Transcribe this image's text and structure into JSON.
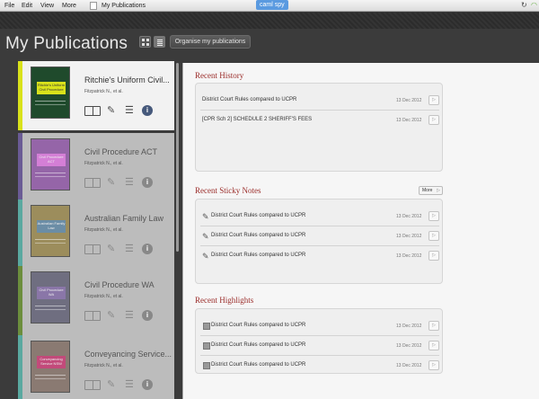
{
  "menubar": {
    "items": [
      "File",
      "Edit",
      "View",
      "More"
    ],
    "window_title": "My Publications",
    "tag": "caml spy"
  },
  "header": {
    "title": "My Publications",
    "organise_label": "Organise my publications"
  },
  "publications": [
    {
      "title": "Ritchie's Uniform Civil...",
      "author": "Fitzpatrick N., et al.",
      "accent": "#d9e21b",
      "cover_color": "#1f4a2c",
      "label_color": "#d9e21b",
      "cover_text": "Ritchie's Uniform Civil Procedure"
    },
    {
      "title": "Civil Procedure ACT",
      "author": "Fitzpatrick N., et al.",
      "accent": "#6a5b95",
      "cover_color": "#9565a8",
      "label_color": "#d47fd6",
      "cover_text": "Civil Procedure ACT"
    },
    {
      "title": "Australian Family Law",
      "author": "Fitzpatrick N., et al.",
      "accent": "#5aa9a0",
      "cover_color": "#9c8d5c",
      "label_color": "#6b8da6",
      "cover_text": "Australian Family Law"
    },
    {
      "title": "Civil Procedure WA",
      "author": "Fitzpatrick N., et al.",
      "accent": "#6c8e3d",
      "cover_color": "#6f6e80",
      "label_color": "#8a76a8",
      "cover_text": "Civil Procedure WA"
    },
    {
      "title": "Conveyancing Service...",
      "author": "Fitzpatrick N., et al.",
      "accent": "#5aa9a0",
      "cover_color": "#8a7a72",
      "label_color": "#c24a7a",
      "cover_text": "Conveyancing Service NSW"
    }
  ],
  "recent_history": {
    "title": "Recent History",
    "items": [
      {
        "text": "District Court Rules compared to UCPR",
        "date": "13 Dec 2012"
      },
      {
        "text": "[CPR Sch 2] SCHEDULE 2 SHERIFF'S FEES",
        "date": "13 Dec 2012"
      }
    ]
  },
  "recent_sticky_notes": {
    "title": "Recent Sticky Notes",
    "more_label": "More",
    "items": [
      {
        "text": "District Court Rules compared to UCPR",
        "date": "13 Dec 2012"
      },
      {
        "text": "District Court Rules compared to UCPR",
        "date": "13 Dec 2012"
      },
      {
        "text": "District Court Rules compared to UCPR",
        "date": "13 Dec 2012"
      }
    ]
  },
  "recent_highlights": {
    "title": "Recent Highlights",
    "items": [
      {
        "text": "District Court Rules compared to UCPR",
        "date": "13 Dec 2012"
      },
      {
        "text": "District Court Rules compared to UCPR",
        "date": "13 Dec 2012"
      },
      {
        "text": "District Court Rules compared to UCPR",
        "date": "13 Dec 2012"
      }
    ]
  }
}
